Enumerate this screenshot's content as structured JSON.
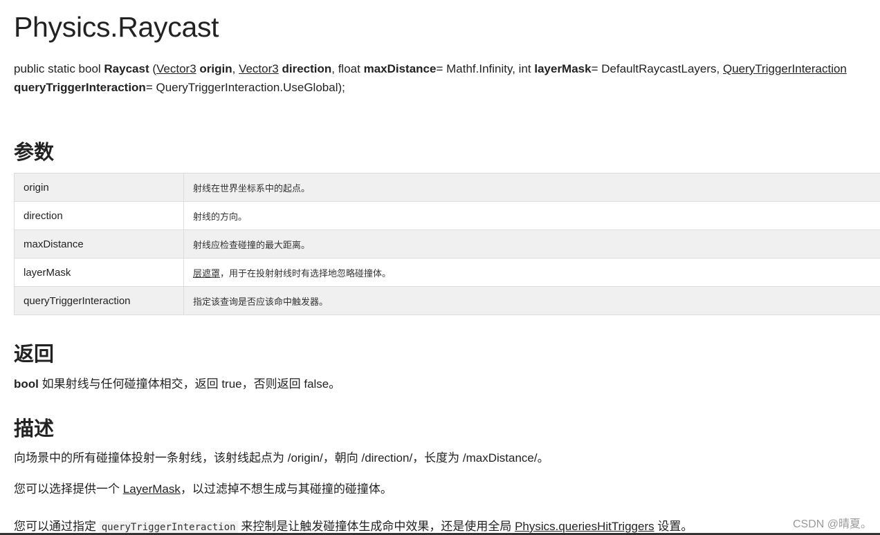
{
  "title": "Physics.Raycast",
  "signature": {
    "prefix": "public static bool ",
    "method": "Raycast",
    "open": " (",
    "t1": "Vector3",
    "p1": "origin",
    "sep1": ", ",
    "t2": "Vector3",
    "p2": "direction",
    "mid2": ", float ",
    "p3": "maxDistance",
    "d3": "= Mathf.Infinity, int ",
    "p4": "layerMask",
    "d4": "= DefaultRaycastLayers, ",
    "t5": "QueryTriggerInteraction",
    "p5": "queryTriggerInteraction",
    "d5": "= QueryTriggerInteraction.UseGlobal);"
  },
  "params_heading": "参数",
  "params": [
    {
      "name": "origin",
      "desc": "射线在世界坐标系中的起点。"
    },
    {
      "name": "direction",
      "desc": "射线的方向。"
    },
    {
      "name": "maxDistance",
      "desc": "射线应检查碰撞的最大距离。"
    },
    {
      "name": "layerMask",
      "desc_link": "层遮罩",
      "desc": "，用于在投射射线时有选择地忽略碰撞体。"
    },
    {
      "name": "queryTriggerInteraction",
      "desc": "指定该查询是否应该命中触发器。"
    }
  ],
  "returns_heading": "返回",
  "returns": {
    "type": "bool",
    "text": " 如果射线与任何碰撞体相交，返回 true，否则返回 false。"
  },
  "desc_heading": "描述",
  "desc1": "向场景中的所有碰撞体投射一条射线，该射线起点为 /origin/，朝向 /direction/，长度为 /maxDistance/。",
  "desc2": {
    "pre": "您可以选择提供一个 ",
    "link": "LayerMask",
    "post": "，以过滤掉不想生成与其碰撞的碰撞体。"
  },
  "desc3": {
    "pre": "您可以通过指定 ",
    "code": "queryTriggerInteraction",
    "mid": " 来控制是让触发碰撞体生成命中效果，还是使用全局 ",
    "link": "Physics.queriesHitTriggers",
    "post": " 设置。"
  },
  "watermark": "CSDN @晴夏。"
}
